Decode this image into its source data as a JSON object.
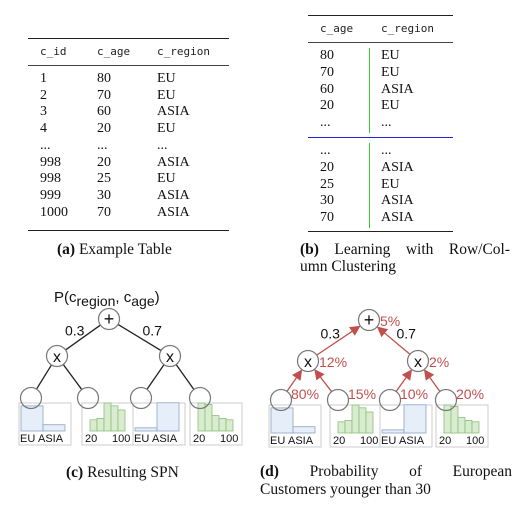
{
  "panel_a": {
    "columns": [
      "c_id",
      "c_age",
      "c_region"
    ],
    "rows": [
      [
        "1",
        "80",
        "EU"
      ],
      [
        "2",
        "70",
        "EU"
      ],
      [
        "3",
        "60",
        "ASIA"
      ],
      [
        "4",
        "20",
        "EU"
      ],
      [
        "...",
        "...",
        "..."
      ],
      [
        "998",
        "20",
        "ASIA"
      ],
      [
        "998",
        "25",
        "EU"
      ],
      [
        "999",
        "30",
        "ASIA"
      ],
      [
        "1000",
        "70",
        "ASIA"
      ]
    ],
    "caption_label": "(a)",
    "caption_text": "Example Table"
  },
  "panel_b": {
    "columns": [
      "c_age",
      "c_region"
    ],
    "cluster_top": [
      [
        "80",
        "EU"
      ],
      [
        "70",
        "EU"
      ],
      [
        "60",
        "ASIA"
      ],
      [
        "20",
        "EU"
      ],
      [
        "...",
        "..."
      ]
    ],
    "cluster_bottom": [
      [
        "...",
        "..."
      ],
      [
        "20",
        "ASIA"
      ],
      [
        "25",
        "EU"
      ],
      [
        "30",
        "ASIA"
      ],
      [
        "70",
        "ASIA"
      ]
    ],
    "row_split_color": "#2222dd",
    "column_split_color": "#33cc33",
    "caption_label": "(b)",
    "caption_line1": "Learning with Row/Col-",
    "caption_line2": "umn Clustering"
  },
  "panel_c": {
    "title": "P(c",
    "title_sub1": "region",
    "title_mid": ", c",
    "title_sub2": "age",
    "title_end": ")",
    "sum_symbol": "+",
    "product_symbol": "x",
    "weights": [
      "0.3",
      "0.7"
    ],
    "leaves": [
      {
        "type": "categorical",
        "labels": [
          "EU",
          "ASIA"
        ],
        "values": [
          0.8,
          0.2
        ]
      },
      {
        "type": "histogram",
        "labels": [
          "20",
          "100"
        ],
        "values": [
          0.4,
          0.45,
          1.0,
          0.9,
          0.75
        ]
      },
      {
        "type": "categorical",
        "labels": [
          "EU",
          "ASIA"
        ],
        "values": [
          0.1,
          0.9
        ]
      },
      {
        "type": "histogram",
        "labels": [
          "20",
          "100"
        ],
        "values": [
          1.0,
          0.95,
          0.55,
          0.45,
          0.4
        ]
      }
    ],
    "caption_label": "(c)",
    "caption_text": "Resulting SPN"
  },
  "panel_d": {
    "sum_symbol": "+",
    "product_symbol": "x",
    "weights": [
      "0.3",
      "0.7"
    ],
    "root_prob": "5%",
    "product_probs": [
      "12%",
      "2%"
    ],
    "leaf_probs": [
      "80%",
      "15%",
      "10%",
      "20%"
    ],
    "arrow_color": "#c0504d",
    "caption_label": "(d)",
    "caption_line1": "Probability of European",
    "caption_line2": "Customers younger than 30"
  },
  "colors": {
    "categorical_fill": "#e6eef9",
    "categorical_stroke": "#8da2c4",
    "histogram_fill": "#d9ecd0",
    "histogram_stroke": "#8cc07a",
    "node_stroke": "#777777",
    "box_stroke": "#cccccc",
    "prob_text": "#c0504d"
  }
}
